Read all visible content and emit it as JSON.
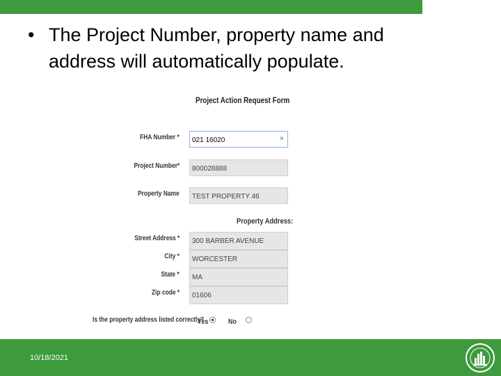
{
  "slide": {
    "bullet_symbol": "•",
    "bullet_text": "The Project Number, property name and address will automatically populate.",
    "footer_date": "10/18/2021",
    "colors": {
      "accent_green": "#3d9a3d",
      "field_bg": "#e6e6e6"
    }
  },
  "form": {
    "title": "Project Action Request Form",
    "fields": {
      "fha_number": {
        "label": "FHA Number *",
        "value": "021 16020",
        "clear_icon": "×"
      },
      "project_number": {
        "label": "Project Number*",
        "value": "800028888"
      },
      "property_name": {
        "label": "Property Name",
        "value": "TEST PROPERTY 46"
      },
      "street_address": {
        "label": "Street Address *",
        "value": "300 BARBER AVENUE"
      },
      "city": {
        "label": "City *",
        "value": "WORCESTER"
      },
      "state": {
        "label": "State *",
        "value": "MA"
      },
      "zip_code": {
        "label": "Zip code *",
        "value": "01606"
      }
    },
    "property_address_heading": "Property Address:",
    "address_question": {
      "text": "Is the property address listed correctly?",
      "yes_label": "Yes",
      "no_label": "No",
      "selected": "Yes"
    }
  }
}
